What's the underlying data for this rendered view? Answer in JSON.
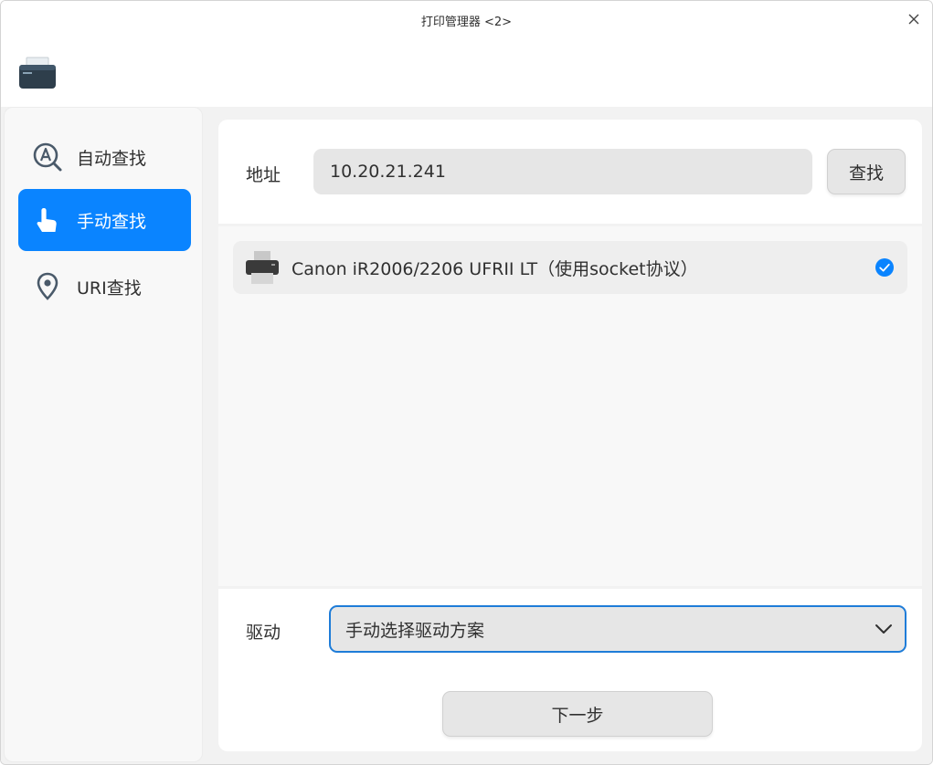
{
  "window": {
    "title": "打印管理器 <2>"
  },
  "sidebar": {
    "items": [
      {
        "label": "自动查找",
        "icon": "auto-search-icon",
        "active": false
      },
      {
        "label": "手动查找",
        "icon": "hand-pointer-icon",
        "active": true
      },
      {
        "label": "URI查找",
        "icon": "location-pin-icon",
        "active": false
      }
    ]
  },
  "address": {
    "label": "地址",
    "value": "10.20.21.241",
    "search_button": "查找"
  },
  "printers": [
    {
      "name": "Canon iR2006/2206 UFRII LT（使用socket协议）",
      "selected": true
    }
  ],
  "driver": {
    "label": "驱动",
    "selected": "手动选择驱动方案"
  },
  "footer": {
    "next_button": "下一步"
  },
  "colors": {
    "accent": "#0a84ff",
    "select_border": "#1e7cd8"
  }
}
